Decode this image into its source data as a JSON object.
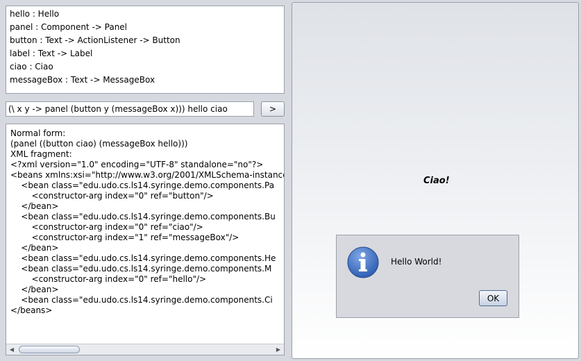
{
  "types": [
    "hello : Hello",
    "panel : Component -> Panel",
    "button : Text -> ActionListener -> Button",
    "label : Text -> Label",
    "ciao : Ciao",
    "messageBox : Text -> MessageBox"
  ],
  "expression": {
    "value": "(\\ x y -> panel (button y (messageBox x))) hello ciao"
  },
  "eval_button_label": ">",
  "output_lines": [
    "Normal form:",
    "(panel ((button ciao) (messageBox hello)))",
    "XML fragment:",
    "<?xml version=\"1.0\" encoding=\"UTF-8\" standalone=\"no\"?>",
    "<beans xmlns:xsi=\"http://www.w3.org/2001/XMLSchema-instance",
    "    <bean class=\"edu.udo.cs.ls14.syringe.demo.components.Pa",
    "        <constructor-arg index=\"0\" ref=\"button\"/>",
    "    </bean>",
    "    <bean class=\"edu.udo.cs.ls14.syringe.demo.components.Bu",
    "        <constructor-arg index=\"0\" ref=\"ciao\"/>",
    "        <constructor-arg index=\"1\" ref=\"messageBox\"/>",
    "    </bean>",
    "    <bean class=\"edu.udo.cs.ls14.syringe.demo.components.He",
    "    <bean class=\"edu.udo.cs.ls14.syringe.demo.components.M",
    "        <constructor-arg index=\"0\" ref=\"hello\"/>",
    "    </bean>",
    "    <bean class=\"edu.udo.cs.ls14.syringe.demo.components.Ci",
    "</beans>"
  ],
  "preview": {
    "ciao_label": "Ciao!"
  },
  "message_box": {
    "message": "Hello World!",
    "ok_label": "OK",
    "icon": "info-icon"
  },
  "colors": {
    "info_icon_blue": "#2f5fb3",
    "ok_border": "#4f6a90"
  }
}
